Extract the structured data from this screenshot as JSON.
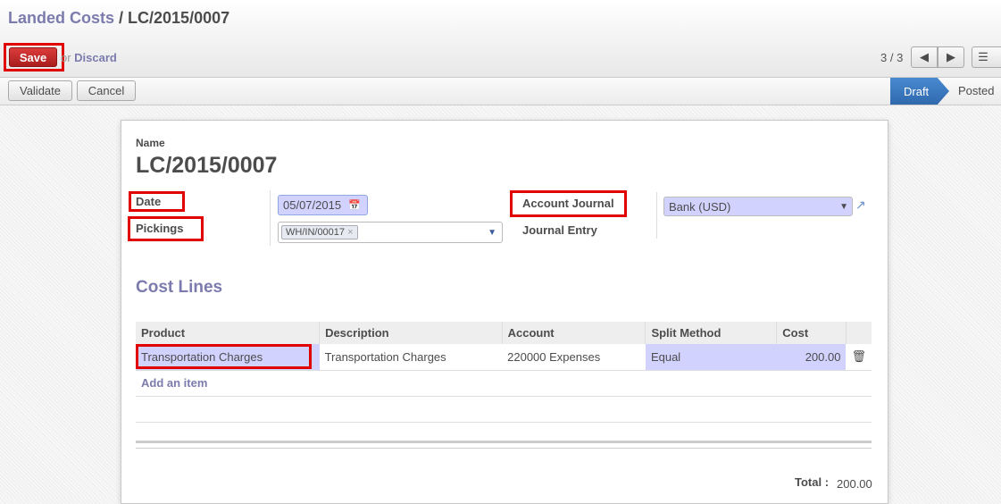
{
  "breadcrumb": {
    "parent": "Landed Costs",
    "separator": " / ",
    "current": "LC/2015/0007"
  },
  "toolbar": {
    "save": "Save",
    "or": "or ",
    "discard": "Discard",
    "pager": "3 / 3"
  },
  "statusbar": {
    "validate": "Validate",
    "cancel": "Cancel",
    "stages": [
      "Draft",
      "Posted"
    ],
    "active_stage": "Draft"
  },
  "form": {
    "name_label": "Name",
    "name": "LC/2015/0007",
    "date_label": "Date",
    "date": "05/07/2015",
    "pickings_label": "Pickings",
    "pickings": [
      "WH/IN/00017"
    ],
    "account_journal_label": "Account Journal",
    "account_journal": "Bank (USD)",
    "journal_entry_label": "Journal Entry"
  },
  "cost_lines": {
    "title": "Cost Lines",
    "columns": [
      "Product",
      "Description",
      "Account",
      "Split Method",
      "Cost"
    ],
    "rows": [
      {
        "product": "Transportation Charges",
        "description": "Transportation Charges",
        "account": "220000 Expenses",
        "split_method": "Equal",
        "cost": "200.00"
      }
    ],
    "add_item": "Add an item",
    "total_label": "Total :",
    "total": "200.00"
  },
  "colors": {
    "accent": "#7c7bad",
    "save": "#c02828",
    "highlight": "#e00000",
    "active_stage": "#3a78bd",
    "selected_cell": "#d2d2ff"
  }
}
